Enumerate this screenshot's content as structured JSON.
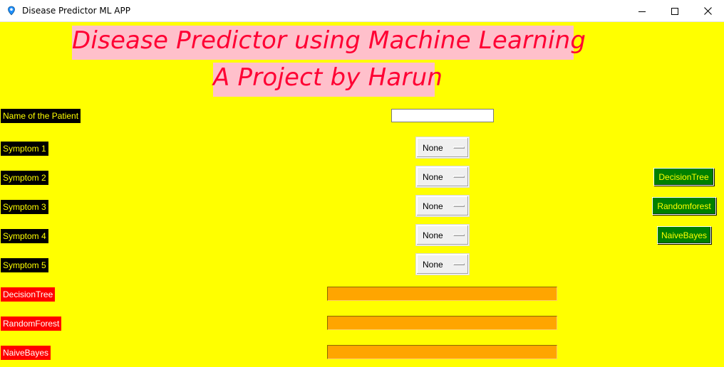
{
  "window": {
    "title": "Disease Predictor ML APP",
    "icon": "location-pin-icon"
  },
  "header": {
    "line1": "Disease Predictor using Machine Learning",
    "line2": "A Project by Harun"
  },
  "colors": {
    "background": "#ffff00",
    "heading_bg": "#ffc0cb",
    "heading_text": "#ff0033",
    "label_bg": "#000000",
    "label_text": "#ffff00",
    "result_label_bg": "#ff0000",
    "result_bg": "#ffa500",
    "button_bg": "#008000",
    "button_text": "#ffff00"
  },
  "patient": {
    "label": "Name of the Patient",
    "value": "",
    "placeholder": ""
  },
  "symptoms": [
    {
      "label": "Symptom 1",
      "value": "None"
    },
    {
      "label": "Symptom 2",
      "value": "None"
    },
    {
      "label": "Symptom 3",
      "value": "None"
    },
    {
      "label": "Symptom 4",
      "value": "None"
    },
    {
      "label": "Symptom 5",
      "value": "None"
    }
  ],
  "buttons": {
    "decision_tree": "DecisionTree",
    "random_forest": "Randomforest",
    "naive_bayes": "NaiveBayes"
  },
  "results": [
    {
      "label": "DecisionTree",
      "value": ""
    },
    {
      "label": "RandomForest",
      "value": ""
    },
    {
      "label": "NaiveBayes",
      "value": ""
    }
  ]
}
